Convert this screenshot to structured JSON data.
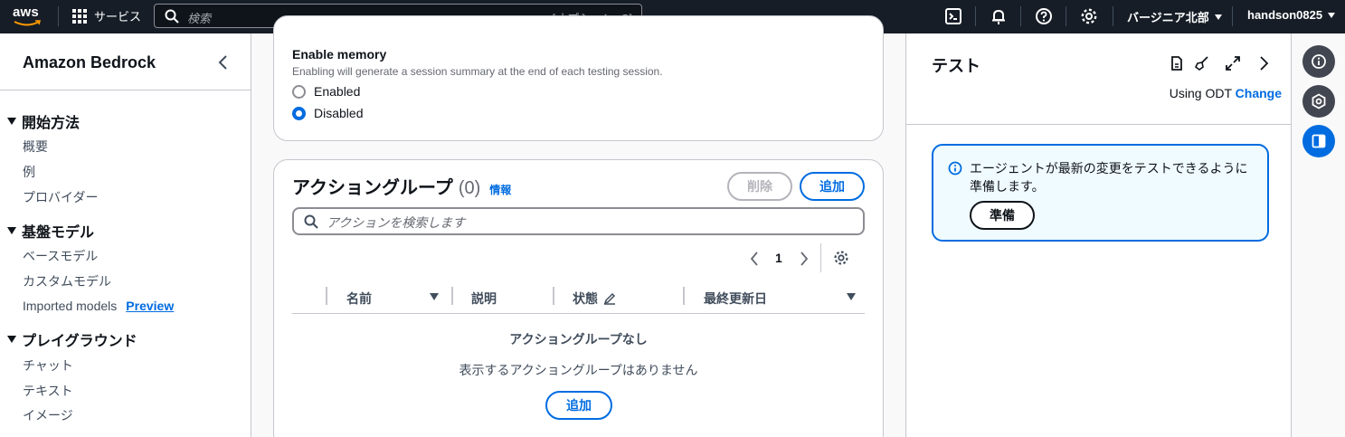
{
  "topnav": {
    "logo": "aws",
    "services": "サービス",
    "search_placeholder": "検索",
    "search_shortcut": "[オプション+S]",
    "region": "バージニア北部",
    "user": "handson0825"
  },
  "sidebar": {
    "title": "Amazon Bedrock",
    "sections": [
      {
        "label": "開始方法",
        "items": [
          "概要",
          "例",
          "プロバイダー"
        ]
      },
      {
        "label": "基盤モデル",
        "items": [
          "ベースモデル",
          "カスタムモデル",
          "Imported models"
        ]
      },
      {
        "label": "プレイグラウンド",
        "items": [
          "チャット",
          "テキスト",
          "イメージ"
        ]
      }
    ],
    "preview_badge": "Preview"
  },
  "memory": {
    "title": "Enable memory",
    "description": "Enabling will generate a session summary at the end of each testing session.",
    "options": [
      "Enabled",
      "Disabled"
    ],
    "selected": "Disabled"
  },
  "action_groups": {
    "title": "アクショングループ",
    "count": "(0)",
    "info": "情報",
    "delete_label": "削除",
    "add_label": "追加",
    "search_placeholder": "アクションを検索します",
    "page": "1",
    "columns": [
      "名前",
      "説明",
      "状態",
      "最終更新日"
    ],
    "empty_title": "アクショングループなし",
    "empty_desc": "表示するアクショングループはありません",
    "empty_add_label": "追加"
  },
  "test_panel": {
    "title": "テスト",
    "odt_text": "Using ODT",
    "odt_change": "Change",
    "alert_text": "エージェントが最新の変更をテストできるように準備します。",
    "prepare_label": "準備"
  },
  "colors": {
    "accent": "#006ce0",
    "nav_bg": "#161d26"
  }
}
